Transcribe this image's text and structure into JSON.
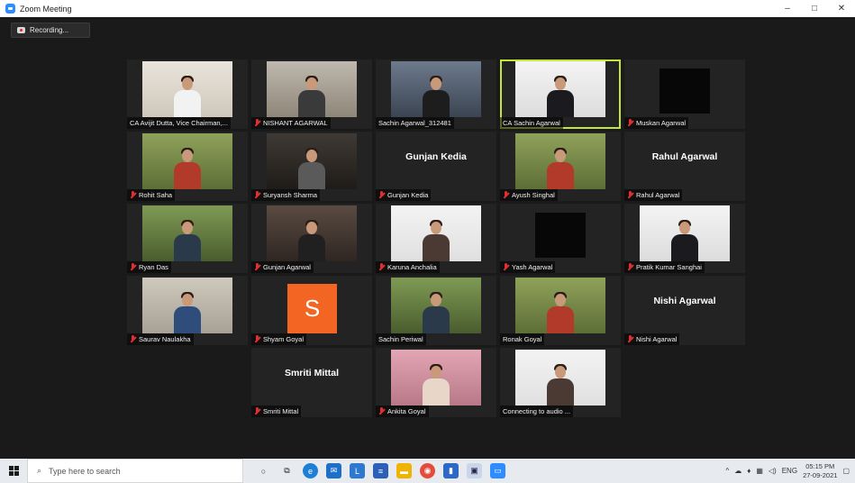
{
  "window": {
    "title": "Zoom Meeting",
    "minimize": "–",
    "maximize": "□",
    "close": "✕"
  },
  "recording": {
    "label": "Recording..."
  },
  "participants": [
    {
      "name": "CA Avijit Dutta, Vice Chairman,...",
      "muted": false,
      "kind": "video",
      "scene": "office"
    },
    {
      "name": "NISHANT AGARWAL",
      "muted": true,
      "kind": "video",
      "scene": "room"
    },
    {
      "name": "Sachin Agarwal_312481",
      "muted": false,
      "kind": "video",
      "scene": "room2"
    },
    {
      "name": "CA Sachin Agarwal",
      "muted": false,
      "kind": "video",
      "scene": "suit",
      "active": true
    },
    {
      "name": "Muskan Agarwal",
      "muted": true,
      "kind": "black"
    },
    {
      "name": "Rohit Saha",
      "muted": true,
      "kind": "video",
      "scene": "outdoor"
    },
    {
      "name": "Suryansh Sharma",
      "muted": true,
      "kind": "video",
      "scene": "group"
    },
    {
      "name": "Gunjan Kedia",
      "muted": true,
      "kind": "name",
      "big_name": "Gunjan Kedia"
    },
    {
      "name": "Ayush Singhal",
      "muted": true,
      "kind": "video",
      "scene": "outdoor"
    },
    {
      "name": "Rahul Agarwal",
      "muted": true,
      "kind": "name",
      "big_name": "Rahul Agarwal"
    },
    {
      "name": "Ryan Das",
      "muted": true,
      "kind": "video",
      "scene": "garden"
    },
    {
      "name": "Gunjan Agarwal",
      "muted": true,
      "kind": "video",
      "scene": "selfie"
    },
    {
      "name": "Karuna Anchalia",
      "muted": true,
      "kind": "video",
      "scene": "white"
    },
    {
      "name": "Yash Agarwal",
      "muted": true,
      "kind": "black"
    },
    {
      "name": "Pratik Kumar Sanghai",
      "muted": true,
      "kind": "video",
      "scene": "suit"
    },
    {
      "name": "Saurav Naulakha",
      "muted": true,
      "kind": "video",
      "scene": "wall"
    },
    {
      "name": "Shyam Goyal",
      "muted": true,
      "kind": "avatar",
      "initial": "S"
    },
    {
      "name": "Sachin Periwal",
      "muted": false,
      "kind": "video",
      "scene": "garden"
    },
    {
      "name": "Ronak Goyal",
      "muted": false,
      "kind": "video",
      "scene": "outdoor"
    },
    {
      "name": "Nishi Agarwal",
      "muted": true,
      "kind": "name",
      "big_name": "Nishi Agarwal"
    },
    {
      "name": "Smriti Mittal",
      "muted": true,
      "kind": "name",
      "big_name": "Smriti Mittal"
    },
    {
      "name": "Ankita Goyal",
      "muted": true,
      "kind": "video",
      "scene": "pink"
    },
    {
      "name": "Connecting to audio ...",
      "muted": false,
      "kind": "video",
      "scene": "white"
    }
  ],
  "taskbar": {
    "search_placeholder": "Type here to search",
    "language": "ENG",
    "time": "05:15 PM",
    "date": "27-09-2021"
  },
  "colors": {
    "active_border": "#c4e53c",
    "muted_mic": "#e03030",
    "avatar_orange": "#f26522"
  }
}
